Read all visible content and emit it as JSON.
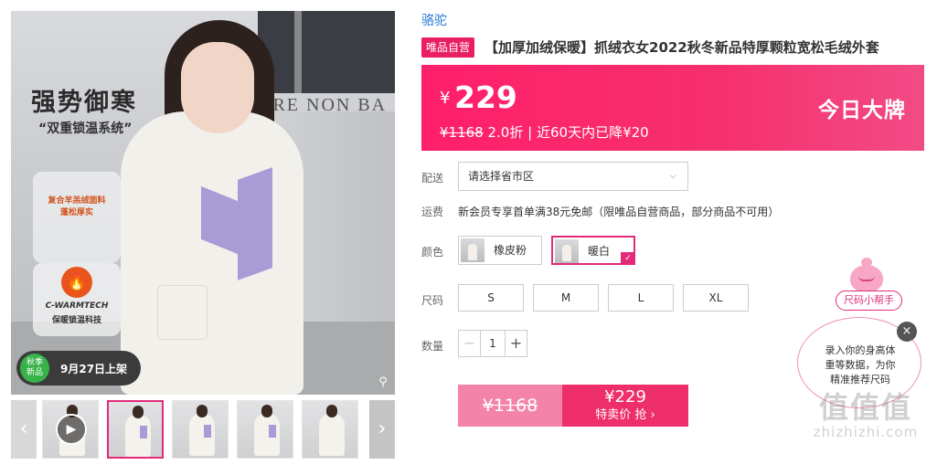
{
  "gallery": {
    "headline": "强势御寒",
    "subheadline": "“双重锁温系统”",
    "feature_line1": "复合羊羔绒面料",
    "feature_line2": "蓬松厚实",
    "tech_brand": "C-WARMTECH",
    "tech_desc": "保暖锁温科技",
    "bg_sign": "ARE NON BA",
    "season_badge_line1": "秋季",
    "season_badge_line2": "新品",
    "launch_date": "9月27日上架",
    "icons": [
      "search-icon",
      "play-icon",
      "chevron-left-icon",
      "chevron-right-icon",
      "fire-icon"
    ],
    "thumbnail_count": 6
  },
  "product": {
    "brand": "骆驼",
    "self_operated_tag": "唯品自营",
    "title": "【加厚加绒保暖】抓绒衣女2022秋冬新品特厚颗粒宽松毛绒外套"
  },
  "price_banner": {
    "currency": "¥",
    "price": "229",
    "original_price": "¥1168",
    "discount": "2.0折",
    "separator": "|",
    "note": "近60天内已降¥20",
    "promo_label": "今日大牌",
    "colors": {
      "start": "#ff1f6a",
      "end": "#f14b86"
    }
  },
  "delivery": {
    "label": "配送",
    "placeholder": "请选择省市区"
  },
  "shipping": {
    "label": "运费",
    "text": "新会员专享首单满38元免邮（限唯品自营商品，部分商品不可用）"
  },
  "color_option": {
    "label": "颜色",
    "options": [
      {
        "name": "橡皮粉",
        "selected": false
      },
      {
        "name": "暖白",
        "selected": true
      }
    ],
    "accent": "#e32a7a"
  },
  "size_option": {
    "label": "尺码",
    "options": [
      "S",
      "M",
      "L",
      "XL"
    ]
  },
  "quantity": {
    "label": "数量",
    "value": "1",
    "minus": "−",
    "plus": "+"
  },
  "buy": {
    "original_price": "¥1168",
    "price": "¥229",
    "cta": "特卖价 抢 ›"
  },
  "size_helper": {
    "label": "尺码小帮手",
    "line1": "录入你的身高体",
    "line2": "重等数据，为你",
    "line3": "精准推荐尺码",
    "close": "×"
  },
  "watermark": {
    "big": "值值值",
    "small": "zhizhizhi.com"
  }
}
